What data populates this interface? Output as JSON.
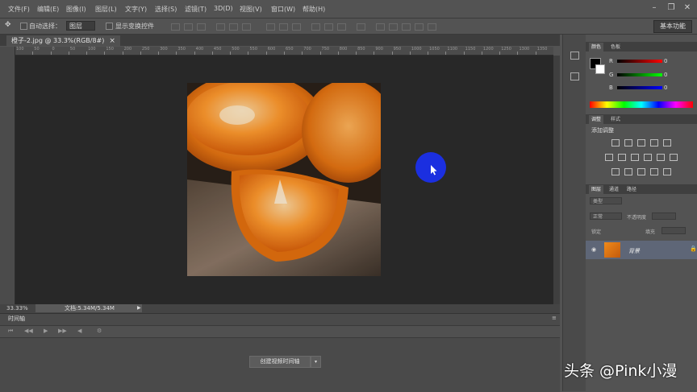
{
  "menu": [
    "文件(F)",
    "编辑(E)",
    "图像(I)",
    "图层(L)",
    "文字(Y)",
    "选择(S)",
    "滤镜(T)",
    "3D(D)",
    "视图(V)",
    "窗口(W)",
    "帮助(H)"
  ],
  "options": {
    "auto_select_label": "自动选择：",
    "auto_select_value": "图层",
    "show_transform_label": "显示变换控件"
  },
  "workspace": "基本功能",
  "document": {
    "tab_title": "橙子-2.jpg @ 33.3%(RGB/8#)",
    "close": "×"
  },
  "ruler_ticks": [
    "100",
    "50",
    "0",
    "50",
    "100",
    "150",
    "200",
    "250",
    "300",
    "350",
    "400",
    "450",
    "500",
    "550",
    "600",
    "650",
    "700",
    "750",
    "800",
    "850",
    "900",
    "950",
    "1000",
    "1050",
    "1100",
    "1150",
    "1200",
    "1250",
    "1300",
    "1350"
  ],
  "status": {
    "zoom": "33.33%",
    "doc_size": "文档:5.34M/5.34M"
  },
  "timeline": {
    "title": "时间轴",
    "create_button": "创建视频时间轴",
    "dropdown": "▾"
  },
  "color_panel": {
    "tabs": [
      "颜色",
      "色板"
    ],
    "rows": [
      {
        "label": "R",
        "value": "0"
      },
      {
        "label": "G",
        "value": "0"
      },
      {
        "label": "B",
        "value": "0"
      }
    ]
  },
  "adjust_panel": {
    "tabs": [
      "调整",
      "样式"
    ],
    "title": "添加调整"
  },
  "layers_panel": {
    "tabs": [
      "图层",
      "通道",
      "路径"
    ],
    "kind": "类型",
    "mode": "正常",
    "opacity_label": "不透明度",
    "lock_label": "锁定",
    "fill_label": "填充",
    "layer_name": "背景"
  },
  "watermark": "头条 @Pink小漫",
  "colors": {
    "accent_blue": "#1b2fe0",
    "canvas": "#282828",
    "panel": "#535353"
  }
}
